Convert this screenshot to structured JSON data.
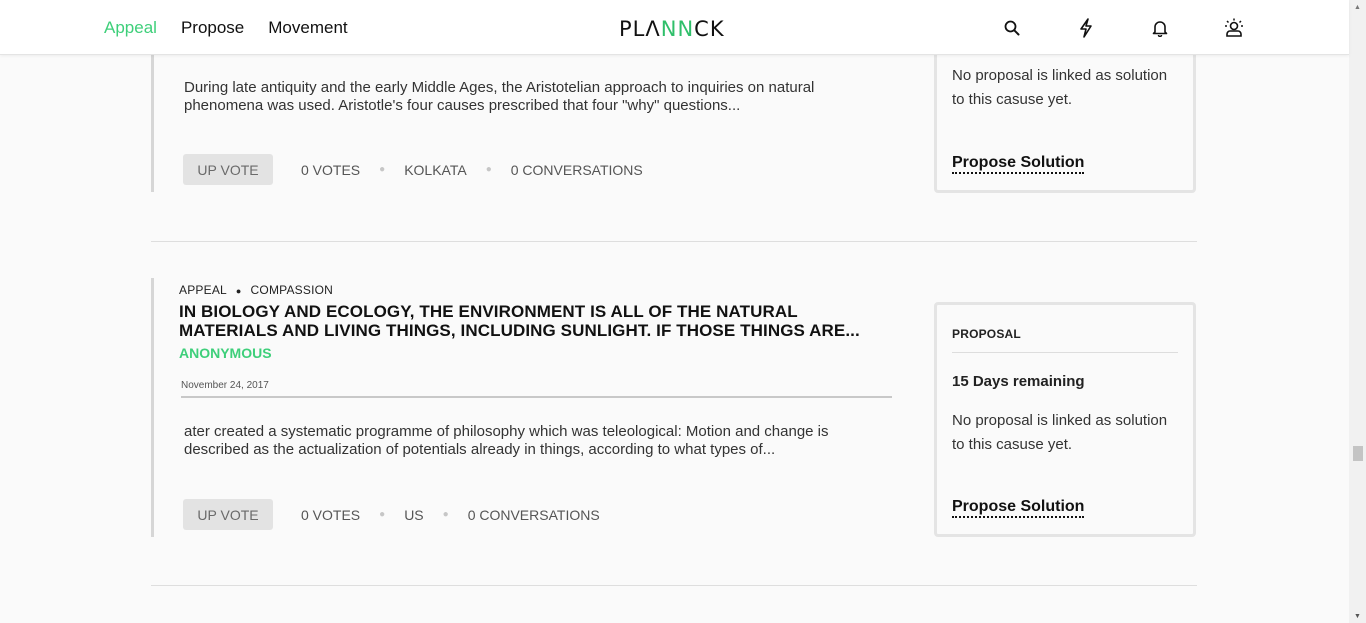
{
  "header": {
    "nav": [
      {
        "label": "Appeal",
        "active": true
      },
      {
        "label": "Propose",
        "active": false
      },
      {
        "label": "Movement",
        "active": false
      }
    ],
    "logo": {
      "part1": "PL",
      "part2": "Λ",
      "part3": "NN",
      "part4": "CK"
    },
    "icons": [
      "search-icon",
      "lightning-icon",
      "bell-icon",
      "user-icon"
    ]
  },
  "cards": [
    {
      "excerpt": "During late antiquity and the early Middle Ages, the Aristotelian approach to inquiries on natural phenomena was used. Aristotle's four causes prescribed that four \"why\" questions...",
      "upvote_label": "UP VOTE",
      "votes": "0 VOTES",
      "location": "KOLKATA",
      "conversations": "0 CONVERSATIONS",
      "panel": {
        "text": "No proposal is linked as solution to this casuse yet.",
        "link": "Propose Solution"
      }
    },
    {
      "category": "APPEAL",
      "subcategory": "COMPASSION",
      "title": "IN BIOLOGY AND ECOLOGY, THE ENVIRONMENT IS ALL OF THE NATURAL MATERIALS AND LIVING THINGS, INCLUDING SUNLIGHT. IF THOSE THINGS ARE...",
      "author": "ANONYMOUS",
      "date": "November 24, 2017",
      "excerpt": "ater created a systematic programme of philosophy which was teleological: Motion and change is described as the actualization of potentials already in things, according to what types of...",
      "upvote_label": "UP VOTE",
      "votes": "0 VOTES",
      "location": "US",
      "conversations": "0 CONVERSATIONS",
      "panel": {
        "label": "PROPOSAL",
        "remaining": "15 Days remaining",
        "text": "No proposal is linked as solution to this casuse yet.",
        "link": "Propose Solution"
      }
    }
  ],
  "colors": {
    "accent": "#3ecf7a",
    "muted": "#e3e3e3"
  }
}
